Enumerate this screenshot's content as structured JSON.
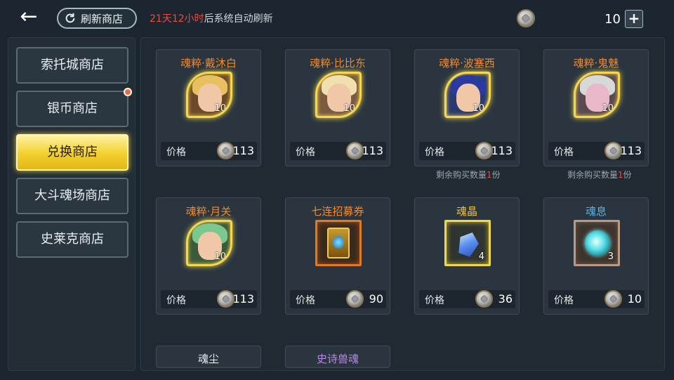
{
  "header": {
    "refresh_button_label": "刷新商店",
    "refresh_note_highlight": "21天12小时",
    "refresh_note_suffix": "后系统自动刷新",
    "currency_amount": "10"
  },
  "sidebar": {
    "items": [
      {
        "label": "索托城商店",
        "active": false
      },
      {
        "label": "银币商店",
        "active": false,
        "badge": true
      },
      {
        "label": "兑换商店",
        "active": true
      },
      {
        "label": "大斗魂场商店",
        "active": false
      },
      {
        "label": "史莱克商店",
        "active": false
      }
    ]
  },
  "price_label": "价格",
  "limit": {
    "prefix": "剩余购买数量",
    "count": "1",
    "suffix": "份"
  },
  "cards": [
    {
      "name": "魂粹·戴沐白",
      "qty": "10",
      "price": "113",
      "color": "#f08a2e"
    },
    {
      "name": "魂粹·比比东",
      "qty": "10",
      "price": "113",
      "color": "#f08a2e"
    },
    {
      "name": "魂粹·波塞西",
      "qty": "10",
      "price": "113",
      "color": "#f08a2e"
    },
    {
      "name": "魂粹·鬼魅",
      "qty": "10",
      "price": "113",
      "color": "#f08a2e"
    },
    {
      "name": "魂粹·月关",
      "qty": "10",
      "price": "113",
      "color": "#f08a2e"
    },
    {
      "name": "七连招募券",
      "qty": "",
      "price": "90",
      "color": "#f08a2e"
    },
    {
      "name": "魂晶",
      "qty": "4",
      "price": "36",
      "color": "#f2c232"
    },
    {
      "name": "魂息",
      "qty": "3",
      "price": "10",
      "color": "#4fb4ea"
    },
    {
      "name": "魂尘",
      "color": "#e8ecef"
    },
    {
      "name": "史诗兽魂",
      "color": "#b58ae6"
    }
  ]
}
